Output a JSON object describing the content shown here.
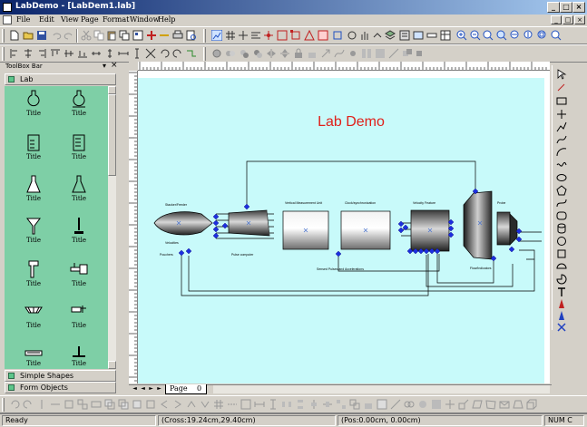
{
  "window": {
    "title": "LabDemo - [LabDem1.lab]"
  },
  "menu": {
    "items": [
      "File",
      "Edit",
      "View",
      "Page",
      "Format",
      "Window",
      "Help"
    ]
  },
  "window_controls": {
    "minimize": "_",
    "maximize": "□",
    "close": "×"
  },
  "toolbox": {
    "title": "ToolBox Bar",
    "pin_glyph": "▾",
    "close_glyph": "×",
    "active_category": "Lab",
    "categories_bottom": [
      "Simple Shapes",
      "Form Objects"
    ],
    "item_label": "Title",
    "items": [
      "round-flask-icon",
      "flask-stand-icon",
      "beaker-icon",
      "graduated-beaker-icon",
      "conical-flask-icon",
      "erlenmeyer-icon",
      "funnel-icon",
      "burner-icon",
      "clamp-icon",
      "tap-icon",
      "dish-icon",
      "scale-icon",
      "tray-icon",
      "stand-icon"
    ]
  },
  "diagram": {
    "title": "Lab Demo",
    "title_color": "#e0201a",
    "labels": {
      "label_a": "Stacker/Feeder",
      "label_b": "Velocities",
      "label_c": "Pouchers",
      "label_d": "Pulse computer",
      "label_e": "Vertical Measurement Unit",
      "label_f": "Clock/synchronization",
      "label_g": "Velocity Feature",
      "label_h": "Probe",
      "label_i": "Sensed Pulses and Accelerations",
      "label_j": "Flow/Indicators"
    }
  },
  "page_tab": {
    "label": "Page",
    "number": "0"
  },
  "status": {
    "ready": "Ready",
    "cross": "(Cross:19.24cm,29.40cm)",
    "pos": "(Pos:0.00cm, 0.00cm)",
    "indicators": "NUM C"
  }
}
